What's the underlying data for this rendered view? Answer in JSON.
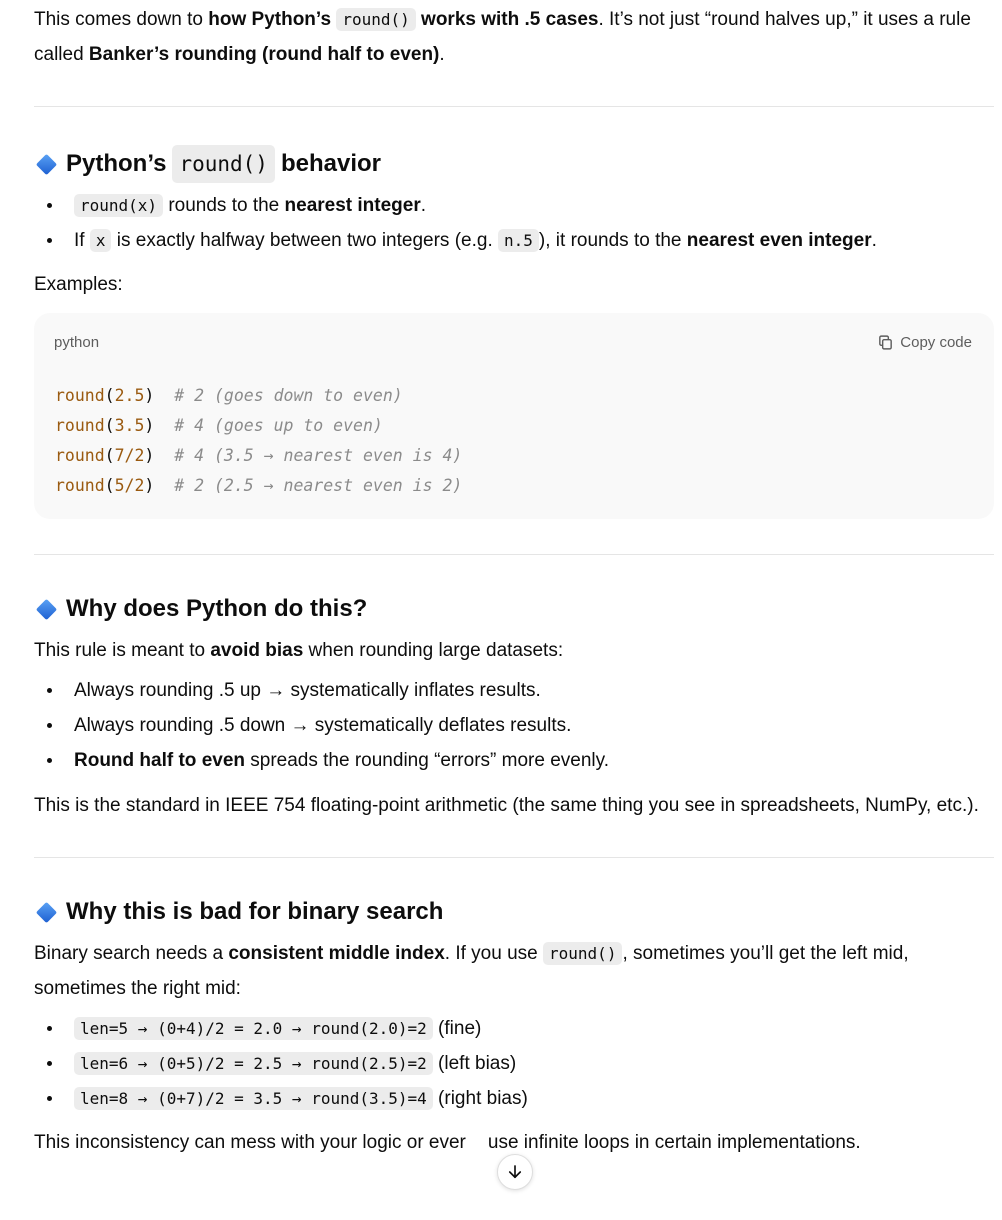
{
  "intro": {
    "p1_a": "This comes down to ",
    "p1_b": "how Python’s ",
    "p1_code": "round()",
    "p1_c": " works with .5 cases",
    "p1_d": ". It’s not just “round halves up,” it uses a rule called ",
    "p1_e": "Banker’s rounding (round half to even)",
    "p1_f": "."
  },
  "section1": {
    "title_a": "Python’s",
    "title_code": "round()",
    "title_b": "behavior",
    "b1_code": "round(x)",
    "b1_a": " rounds to the ",
    "b1_b": "nearest integer",
    "b1_c": ".",
    "b2_a": "If ",
    "b2_code1": "x",
    "b2_b": " is exactly halfway between two integers (e.g. ",
    "b2_code2": "n.5",
    "b2_c": "), it rounds to the ",
    "b2_d": "nearest even integer",
    "b2_e": ".",
    "examples_label": "Examples:"
  },
  "codeblock": {
    "language": "python",
    "copy_label": "Copy code",
    "lines": [
      {
        "fn": "round",
        "arg": "2.5",
        "comment": "# 2 (goes down to even)"
      },
      {
        "fn": "round",
        "arg": "3.5",
        "comment": "# 4 (goes up to even)"
      },
      {
        "fn": "round",
        "arg": "7/2",
        "comment": "# 4 (3.5 → nearest even is 4)"
      },
      {
        "fn": "round",
        "arg": "5/2",
        "comment": "# 2 (2.5 → nearest even is 2)"
      }
    ]
  },
  "section2": {
    "title": "Why does Python do this?",
    "p_a": "This rule is meant to ",
    "p_b": "avoid bias",
    "p_c": " when rounding large datasets:",
    "b1": "Always rounding .5 up → systematically inflates results.",
    "b2": "Always rounding .5 down → systematically deflates results.",
    "b3_a": "Round half to even",
    "b3_b": " spreads the rounding “errors” more evenly.",
    "p2": "This is the standard in IEEE 754 floating-point arithmetic (the same thing you see in spreadsheets, NumPy, etc.)."
  },
  "section3": {
    "title": "Why this is bad for binary search",
    "p_a": "Binary search needs a ",
    "p_b": "consistent middle index",
    "p_c": ". If you use ",
    "p_code": "round()",
    "p_d": ", sometimes you’ll get the left mid, sometimes the right mid:",
    "b1_code": "len=5 → (0+4)/2 = 2.0 → round(2.0)=2",
    "b1_text": " (fine)",
    "b2_code": "len=6 → (0+5)/2 = 2.5 → round(2.5)=2",
    "b2_text": " (left bias)",
    "b3_code": "len=8 → (0+7)/2 = 3.5 → round(3.5)=4",
    "b3_text": " (right bias)",
    "p2_a": "This inconsistency can mess with your logic or ever",
    "p2_b": "use infinite loops in certain implementations."
  },
  "colors": {
    "accent_diamond": "#1d5fd1",
    "code_function": "#9a5a10",
    "code_comment": "#8b8b8b"
  },
  "icons": {
    "section_marker": "blue-diamond-icon",
    "copy": "copy-icon",
    "scroll": "arrow-down-icon"
  }
}
